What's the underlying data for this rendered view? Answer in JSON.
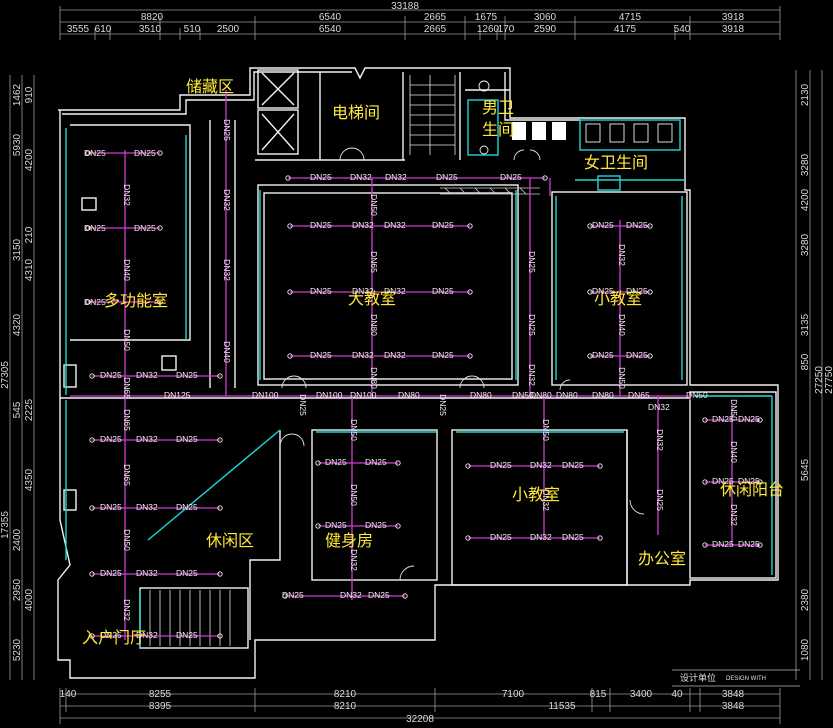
{
  "drawing": {
    "rooms": [
      {
        "id": "storage",
        "label": "储藏区"
      },
      {
        "id": "elevator",
        "label": "电梯间"
      },
      {
        "id": "mens_wc",
        "label": "男卫"
      },
      {
        "id": "mens_wc_2",
        "label": "生间"
      },
      {
        "id": "womens_wc",
        "label": "女卫生间"
      },
      {
        "id": "multi",
        "label": "多功能室"
      },
      {
        "id": "big_class",
        "label": "大教室"
      },
      {
        "id": "small_class_1",
        "label": "小教室"
      },
      {
        "id": "small_class_2",
        "label": "小教室"
      },
      {
        "id": "leisure",
        "label": "休闲区"
      },
      {
        "id": "gym",
        "label": "健身房"
      },
      {
        "id": "office",
        "label": "办公室"
      },
      {
        "id": "balcony",
        "label": "休闲阳台"
      },
      {
        "id": "entrance",
        "label": "入户门厅"
      }
    ],
    "top_dims": {
      "overall": "33188",
      "row1": [
        "8820",
        "6540",
        "2665",
        "1675",
        "3060",
        "4715",
        "3918"
      ],
      "row2": [
        "3555",
        "610",
        "3510",
        "510",
        "2500",
        "6540",
        "2665",
        "1260",
        "170",
        "2590",
        "4175",
        "540",
        "3918"
      ]
    },
    "bottom_dims": {
      "overall": "32208",
      "row1": [
        "140",
        "8255",
        "8210",
        "7100",
        "815",
        "3400",
        "40",
        "3848"
      ],
      "row2": [
        "8395",
        "8210",
        "11535",
        "3848"
      ]
    },
    "left_dims": [
      "1462",
      "910",
      "5930",
      "4200",
      "3150",
      "210",
      "4310",
      "4320",
      "27305",
      "545",
      "2225",
      "4350",
      "17355",
      "2400",
      "2950",
      "4000",
      "5230"
    ],
    "right_dims": [
      "2130",
      "3280",
      "4200",
      "3280",
      "3135",
      "850",
      "27250",
      "27750",
      "5645",
      "2380",
      "1080"
    ],
    "stamp": {
      "title": "设计单位",
      "sub": "DESIGN WITH"
    },
    "pipe_labels": {
      "dn25": "DN25",
      "dn32": "DN32",
      "dn40": "DN40",
      "dn50": "DN50",
      "dn65": "DN65",
      "dn80": "DN80",
      "dn100": "DN100",
      "dn125": "DN125"
    }
  }
}
